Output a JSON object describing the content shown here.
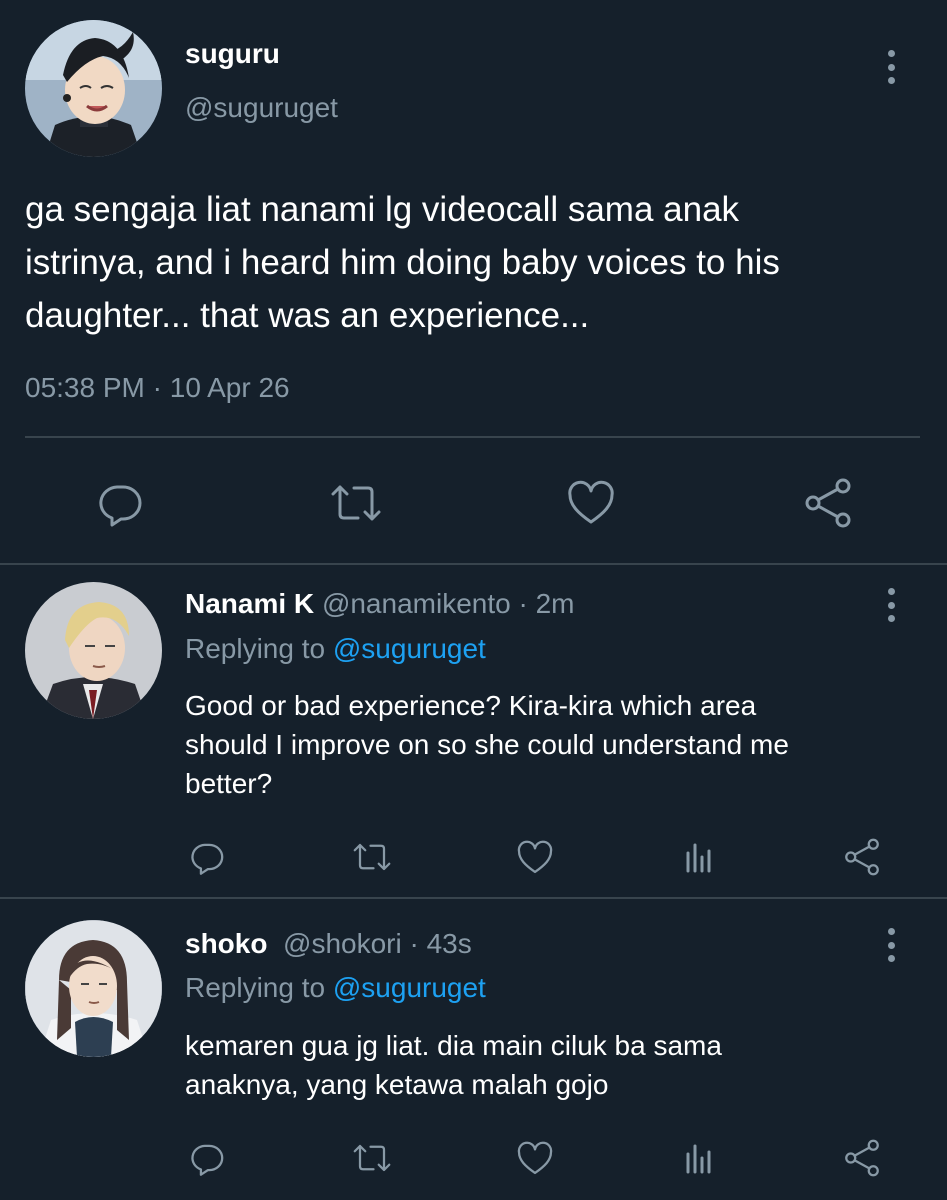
{
  "main_tweet": {
    "display_name": "suguru",
    "handle": "@suguruget",
    "text_lines": [
      "ga sengaja liat nanami lg videocall sama anak",
      "istrinya, and i heard him doing baby voices to his",
      "daughter... that was an experience..."
    ],
    "time": "05:38 PM",
    "separator": "·",
    "date": "10 Apr 26",
    "avatar_icon": "avatar-suguru"
  },
  "replies": [
    {
      "display_name": "Nanami K",
      "handle": "@nanamikento",
      "separator": "·",
      "age": "2m",
      "replying_prefix": "Replying to",
      "replying_handle": "@suguruget",
      "text_lines": [
        "Good or bad experience? Kira-kira which area",
        "should I improve on so she could understand me",
        "better?"
      ],
      "avatar_icon": "avatar-nanami"
    },
    {
      "display_name": "shoko",
      "handle": "@shokori",
      "separator": "·",
      "age": "43s",
      "replying_prefix": "Replying to",
      "replying_handle": "@suguruget",
      "text_lines": [
        "kemaren gua jg liat. dia main ciluk ba sama",
        "anaknya, yang ketawa malah gojo"
      ],
      "avatar_icon": "avatar-shoko"
    }
  ],
  "colors": {
    "background": "#15202b",
    "muted_text": "#8899a6",
    "link": "#1da1f2",
    "divider": "#38444d"
  },
  "icons": [
    "reply-icon",
    "retweet-icon",
    "like-icon",
    "share-icon",
    "analytics-icon",
    "more-icon"
  ]
}
